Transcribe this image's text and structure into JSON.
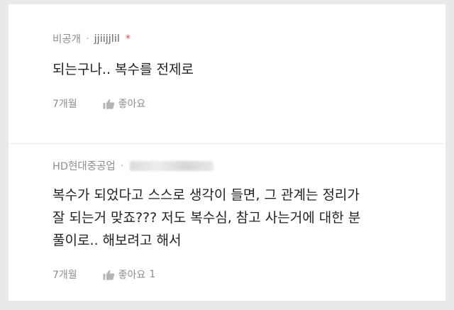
{
  "comments": [
    {
      "author": "비공개",
      "handle": "jjiijjlil",
      "star": "*",
      "text": "되는구나.. 복수를 전제로",
      "time": "7개월",
      "like_label": "좋아요",
      "like_count": ""
    },
    {
      "author": "HD현대중공업",
      "handle": "",
      "star": "",
      "text_lines": [
        "복수가 되었다고 스스로 생각이 들면, 그 관계는 정리가",
        "잘 되는거 맞죠??? 저도 복수심, 참고 사는거에 대한 분",
        "풀이로.. 해보려고 해서"
      ],
      "time": "7개월",
      "like_label": "좋아요",
      "like_count": "1"
    }
  ],
  "icons": {
    "like": "thumbs-up-icon"
  },
  "colors": {
    "background": "#e9e9e9",
    "card": "#ffffff",
    "text": "#222222",
    "meta": "#8e8e8e",
    "star": "#e44a4a"
  }
}
